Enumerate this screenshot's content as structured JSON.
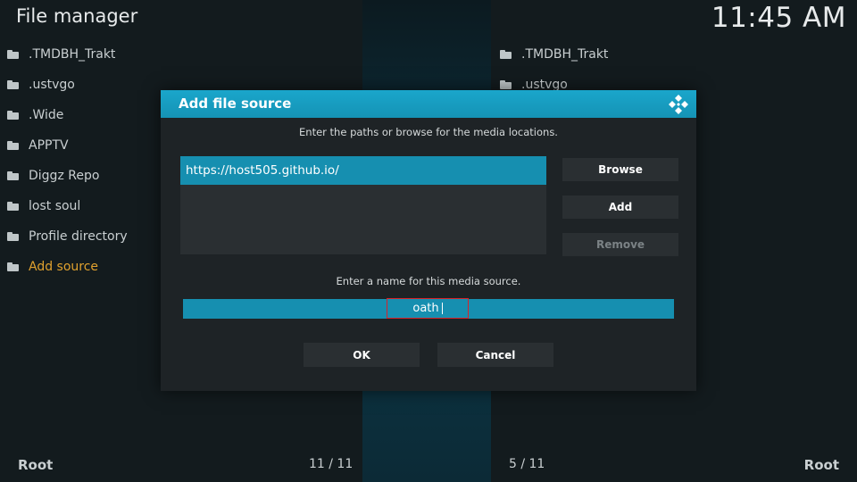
{
  "app": {
    "title": "File manager",
    "clock": "11:45 AM"
  },
  "left_panel": {
    "items": [
      {
        "label": ".TMDBH_Trakt"
      },
      {
        "label": ".ustvgo"
      },
      {
        "label": ".Wide"
      },
      {
        "label": "APPTV"
      },
      {
        "label": "Diggz Repo"
      },
      {
        "label": "lost soul"
      },
      {
        "label": "Profile directory"
      },
      {
        "label": "Add source"
      }
    ],
    "footer_root": "Root",
    "footer_count": "11 / 11"
  },
  "right_panel": {
    "items": [
      {
        "label": ".TMDBH_Trakt"
      },
      {
        "label": ".ustvgo"
      }
    ],
    "footer_root": "Root",
    "footer_count": "5 / 11"
  },
  "dialog": {
    "title": "Add file source",
    "instruction_paths": "Enter the paths or browse for the media locations.",
    "paths": [
      "https://host505.github.io/"
    ],
    "browse_label": "Browse",
    "add_label": "Add",
    "remove_label": "Remove",
    "instruction_name": "Enter a name for this media source.",
    "name_value": "oath",
    "ok_label": "OK",
    "cancel_label": "Cancel"
  },
  "colors": {
    "accent": "#168fb0",
    "active_item": "#e0a12e",
    "focus_border": "#d8232a",
    "dialog_bg": "#1e2326"
  },
  "icons": {
    "folder": "folder-icon",
    "logo": "kodi-logo-icon"
  }
}
